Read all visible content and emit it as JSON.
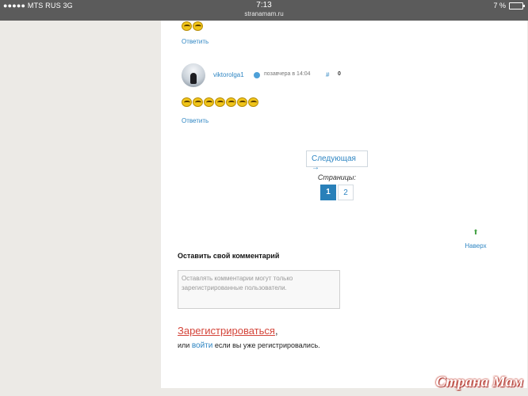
{
  "status_bar": {
    "carrier": "●●●●● MTS RUS  3G",
    "time": "7:13",
    "url": "stranamam.ru",
    "battery_text": "7 %"
  },
  "comments": [
    {
      "emoji_count": 2,
      "reply_label": "Ответить"
    },
    {
      "author": "viktorolga1",
      "timestamp": "позавчера в 14:04",
      "hash": "#",
      "rating": "0",
      "emoji_count": 7,
      "reply_label": "Ответить"
    }
  ],
  "pagination": {
    "next_label": "Следующая →",
    "pages_label": "Страницы:",
    "pages": [
      "1",
      "2"
    ],
    "current_page": "1"
  },
  "to_top": {
    "arrow": "⬆",
    "label": "Наверх"
  },
  "comment_form": {
    "heading": "Оставить свой комментарий",
    "placeholder": "Оставлять комментарии могут только зарегистрированные пользователи."
  },
  "auth": {
    "register_label": "Зарегистрироваться",
    "register_suffix": ",",
    "or_label": "или ",
    "login_label": "войти",
    "tail_label": " если вы уже регистрировались."
  },
  "watermark": "Страна Мам",
  "colors": {
    "link": "#2f86c3",
    "active_page": "#2980b9",
    "register": "#d4453a"
  }
}
